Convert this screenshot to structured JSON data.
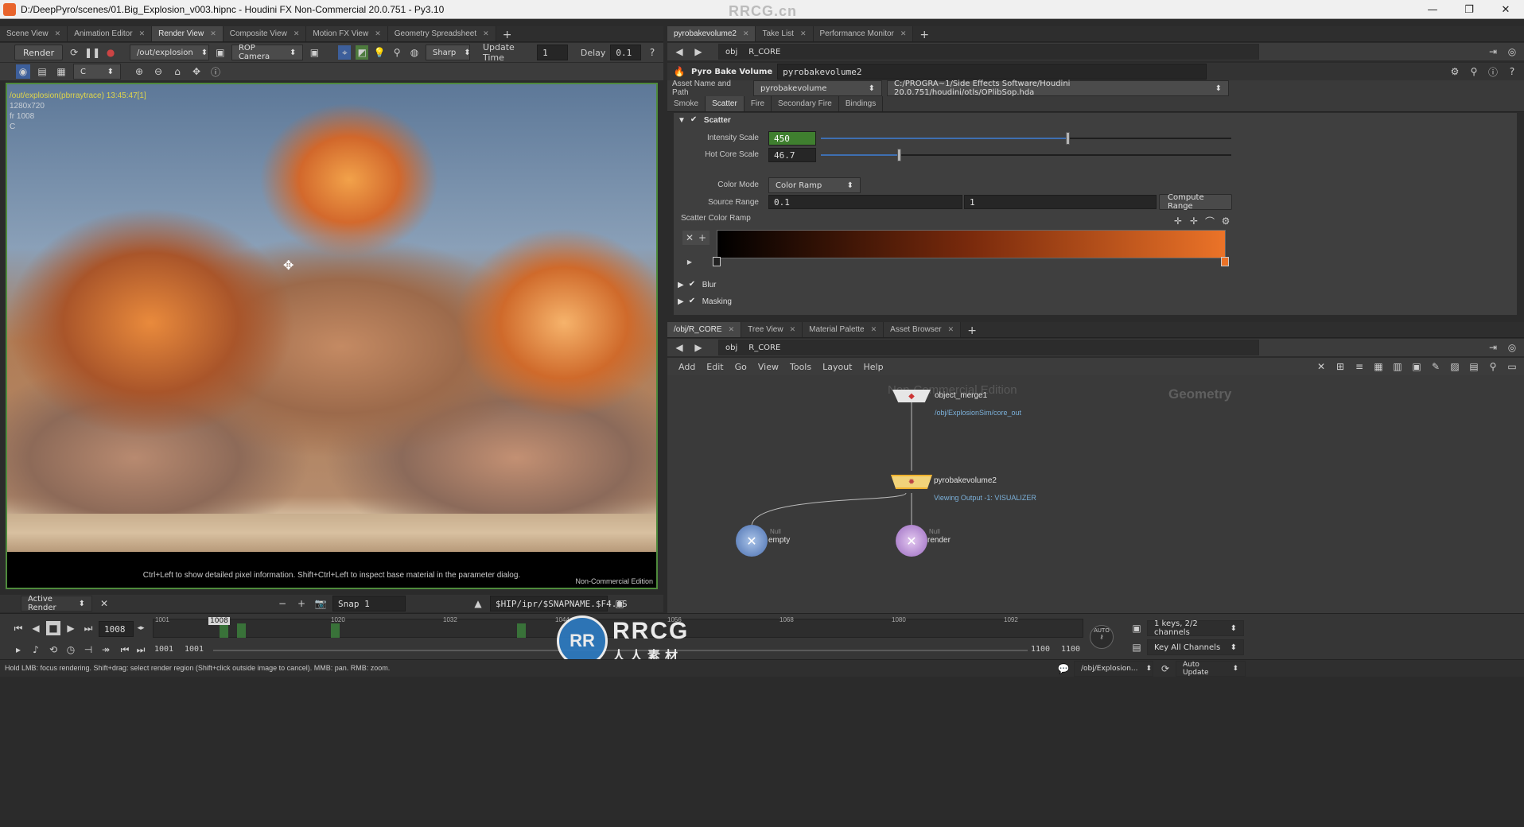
{
  "window": {
    "title": "D:/DeepPyro/scenes/01.Big_Explosion_v003.hipnc - Houdini FX Non-Commercial 20.0.751 - Py3.10",
    "watermark": "RRCG.cn"
  },
  "left_tabs": [
    "Scene View",
    "Animation Editor",
    "Render View",
    "Composite View",
    "Motion FX View",
    "Geometry Spreadsheet"
  ],
  "render_toolbar": {
    "render_label": "Render",
    "rop_path": "/out/explosion",
    "camera": "ROP Camera",
    "filter": "Sharp",
    "update_time_label": "Update Time",
    "update_time_value": "1",
    "delay_label": "Delay",
    "delay_value": "0.1",
    "channel": "C"
  },
  "viewport": {
    "overlay_title": "/out/explosion(pbrraytrace)  13:45:47[1]",
    "overlay_res": "1280x720",
    "overlay_frame": "fr 1008",
    "overlay_channel": "C",
    "hint": "Ctrl+Left to show detailed pixel information. Shift+Ctrl+Left to inspect base material in the parameter dialog.",
    "edition": "Non-Commercial Edition"
  },
  "render_bottom": {
    "active_render": "Active Render",
    "snap": "Snap 1",
    "path": "$HIP/ipr/$SNAPNAME.$F4.$S"
  },
  "right_top_tabs": [
    "pyrobakevolume2",
    "Take List",
    "Performance Monitor"
  ],
  "param_path": {
    "obj": "obj",
    "node": "R_CORE"
  },
  "node_header": {
    "type": "Pyro Bake Volume",
    "name": "pyrobakevolume2",
    "asset_label": "Asset Name and Path",
    "asset_name": "pyrobakevolume",
    "asset_path": "C:/PROGRA~1/Side Effects Software/Houdini 20.0.751/houdini/otls/OPlibSop.hda"
  },
  "param_tabs": [
    "Smoke",
    "Scatter",
    "Fire",
    "Secondary Fire",
    "Bindings"
  ],
  "scatter": {
    "section": "Scatter",
    "intensity_label": "Intensity Scale",
    "intensity_value": "450",
    "intensity_level": 0.6,
    "hotcore_label": "Hot Core Scale",
    "hotcore_value": "46.7",
    "hotcore_level": 0.19,
    "color_mode_label": "Color Mode",
    "color_mode_value": "Color Ramp",
    "source_range_label": "Source Range",
    "source_range_min": "0.1",
    "source_range_max": "1",
    "compute_range": "Compute Range",
    "ramp_label": "Scatter Color Ramp",
    "ramp_colors": [
      "#000000",
      "#7a2a0c",
      "#eb7328"
    ]
  },
  "collapsed_sections": [
    "Blur",
    "Masking"
  ],
  "net_tabs": [
    "/obj/R_CORE",
    "Tree View",
    "Material Palette",
    "Asset Browser"
  ],
  "net_menu": [
    "Add",
    "Edit",
    "Go",
    "View",
    "Tools",
    "Layout",
    "Help"
  ],
  "network": {
    "watermark_edition": "Non-Commercial Edition",
    "context": "Geometry",
    "nodes": {
      "object_merge": {
        "name": "object_merge1",
        "sub": "/obj/ExplosionSim/core_out"
      },
      "pyrobake": {
        "name": "pyrobakevolume2",
        "sub": "Viewing Output -1: VISUALIZER"
      },
      "empty": {
        "type": "Null",
        "name": "empty"
      },
      "render": {
        "type": "Null",
        "name": "render"
      }
    }
  },
  "timeline": {
    "current_frame": "1008",
    "frame_marker": "1008",
    "start": "1001",
    "start2": "1001",
    "end": "1100",
    "end2": "1100",
    "ticks": [
      "1001",
      "1020",
      "1032",
      "1044",
      "1056",
      "1068",
      "1080",
      "1092"
    ],
    "keys_info": "1 keys, 2/2 channels",
    "key_all": "Key All Channels",
    "auto_label": "AUTO"
  },
  "status": {
    "message": "Hold LMB: focus rendering. Shift+drag: select render region (Shift+click outside image to cancel). MMB: pan. RMB: zoom.",
    "path": "/obj/Explosion...",
    "auto_update": "Auto Update"
  },
  "logo": {
    "mark": "RR",
    "brand": "RRCG",
    "cn": "人人素材"
  }
}
